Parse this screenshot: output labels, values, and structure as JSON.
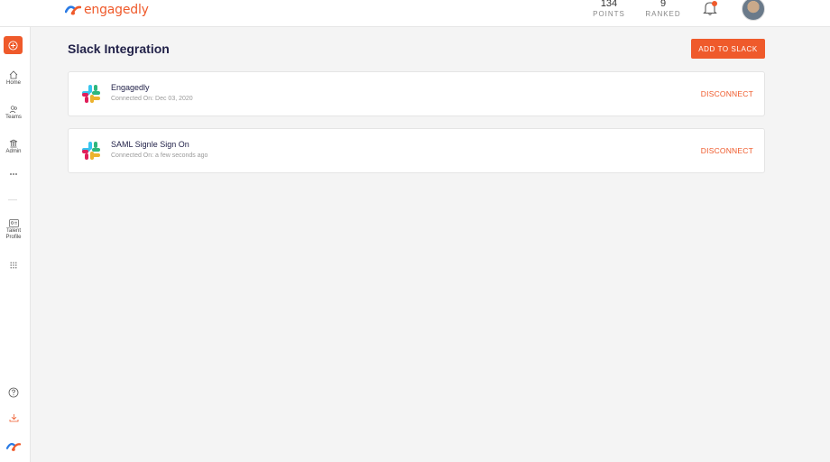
{
  "header": {
    "logo_text": "engagedly",
    "points": {
      "value": "134",
      "label": "POINTS"
    },
    "ranked": {
      "value": "9",
      "label": "RANKED"
    }
  },
  "sidebar": {
    "items": [
      {
        "label": "Home",
        "icon": "home-icon"
      },
      {
        "label": "Teams",
        "icon": "teams-icon"
      },
      {
        "label": "Admin",
        "icon": "admin-icon"
      },
      {
        "label": "Talent Profile",
        "icon": "id-card-icon"
      }
    ]
  },
  "main": {
    "title": "Slack Integration",
    "add_button": "ADD TO SLACK",
    "integrations": [
      {
        "name": "Engagedly",
        "connected": "Connected On: Dec 03, 2020",
        "action": "DISCONNECT"
      },
      {
        "name": "SAML Signle Sign On",
        "connected": "Connected On: a few seconds ago",
        "action": "DISCONNECT"
      }
    ]
  },
  "colors": {
    "accent": "#ef5a2b",
    "background": "#f4f4f4",
    "title": "#23234a"
  }
}
